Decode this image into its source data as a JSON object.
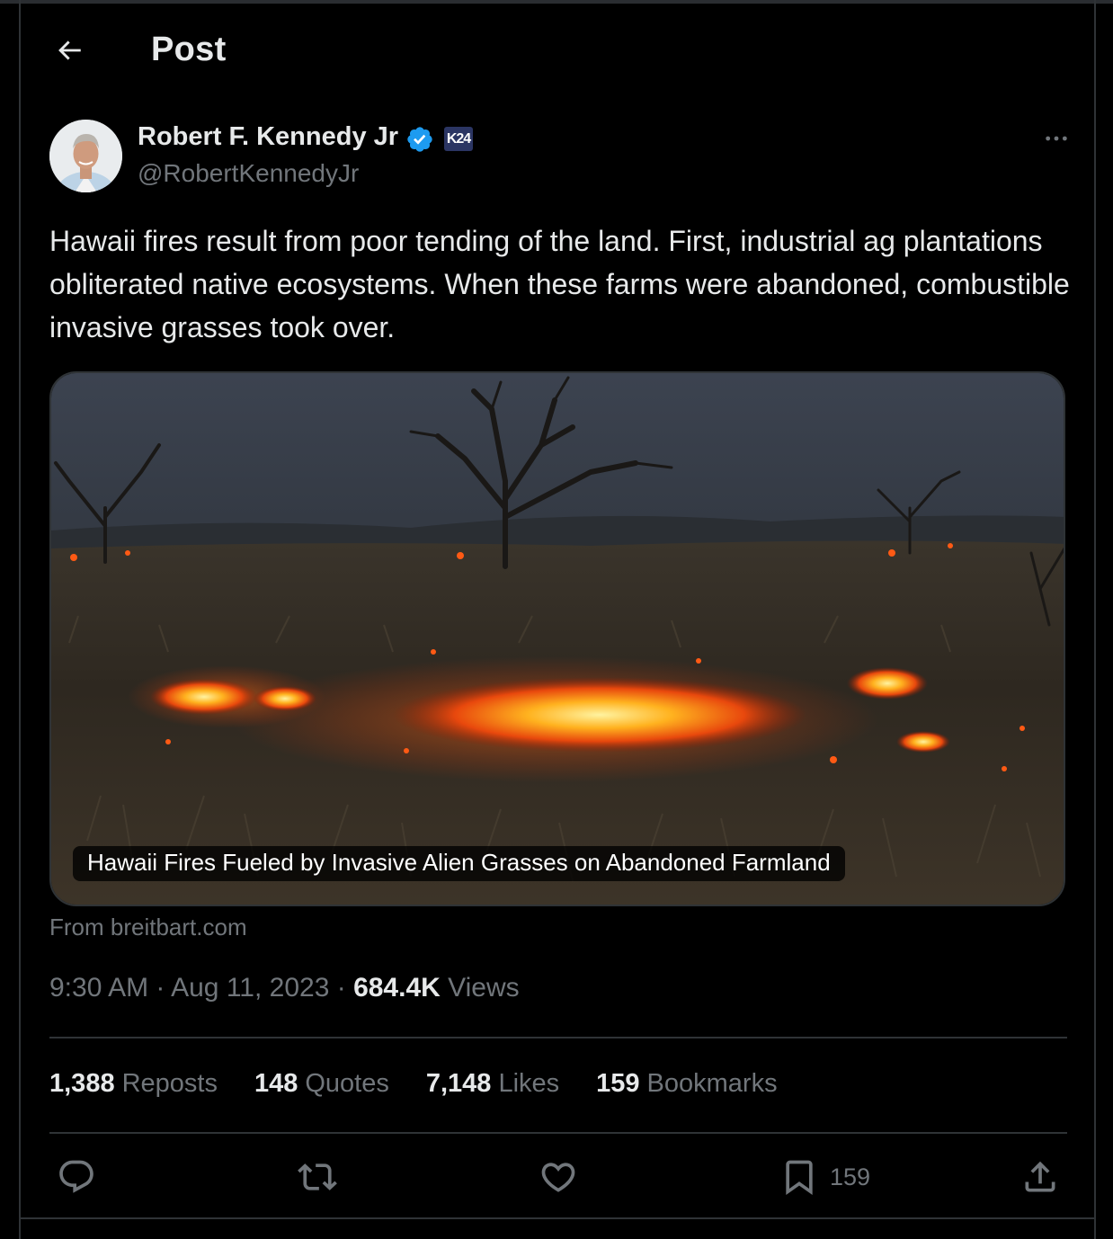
{
  "header": {
    "back_icon": "arrow-left-icon",
    "title": "Post"
  },
  "author": {
    "display_name": "Robert F. Kennedy Jr",
    "handle": "@RobertKennedyJr",
    "verified_icon": "verified-badge-icon",
    "affiliation_badge": "K24",
    "avatar_icon": "avatar",
    "more_icon": "more-horizontal-icon"
  },
  "post": {
    "text": "Hawaii fires result from poor tending of the land. First, industrial ag plantations obliterated native ecosystems. When these farms were abandoned, combustible invasive grasses took over."
  },
  "card": {
    "caption": "Hawaii Fires Fueled by Invasive Alien Grasses on Abandoned Farmland",
    "source": "From breitbart.com"
  },
  "meta": {
    "time": "9:30 AM",
    "separator": "·",
    "date": "Aug 11, 2023",
    "views_count": "684.4K",
    "views_label": "Views"
  },
  "stats": {
    "reposts": {
      "count": "1,388",
      "label": "Reposts"
    },
    "quotes": {
      "count": "148",
      "label": "Quotes"
    },
    "likes": {
      "count": "7,148",
      "label": "Likes"
    },
    "bookmarks": {
      "count": "159",
      "label": "Bookmarks"
    }
  },
  "actions": {
    "reply_icon": "reply-icon",
    "repost_icon": "repost-icon",
    "like_icon": "heart-icon",
    "bookmark_icon": "bookmark-icon",
    "bookmark_count": "159",
    "share_icon": "share-icon"
  },
  "colors": {
    "background": "#000000",
    "text_primary": "#e7e9ea",
    "text_secondary": "#71767b",
    "border": "#2f3336",
    "verified_blue": "#1d9bf0"
  }
}
